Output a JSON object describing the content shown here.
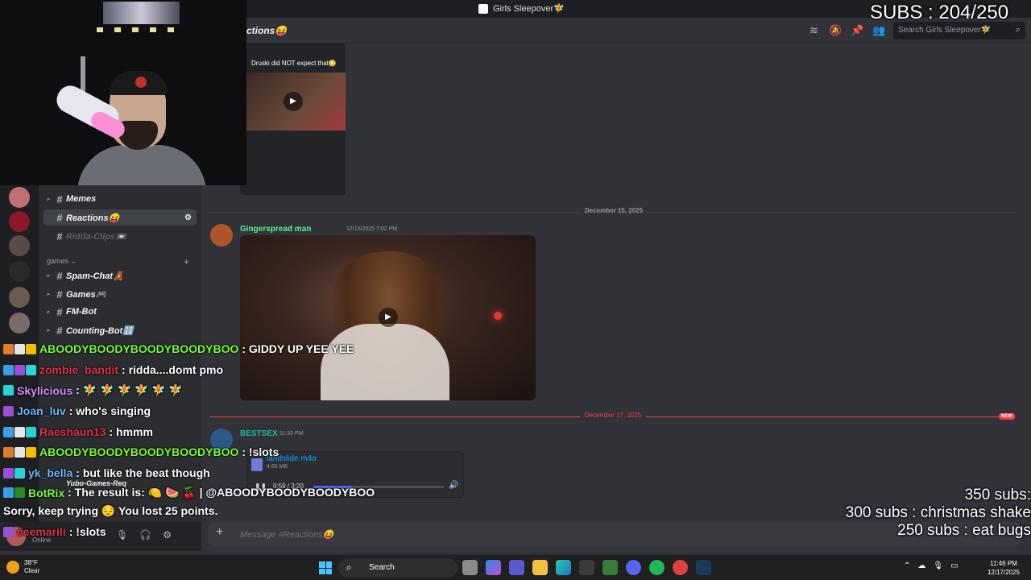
{
  "window": {
    "title": "Girls Sleepover🧚"
  },
  "channel_header": {
    "name": "ctions😝",
    "search_placeholder": "Search Girls Sleepover🧚",
    "icons": [
      "threads-icon",
      "mute-bell-icon",
      "pin-icon",
      "members-icon"
    ]
  },
  "channels": {
    "items": [
      {
        "name": "Memes",
        "active": false,
        "muted": false
      },
      {
        "name": "Reactions😝",
        "active": true,
        "muted": false
      },
      {
        "name": "Ridda-Clips📼",
        "active": false,
        "muted": true
      },
      {
        "name": "Spam-Chat🧸",
        "active": false,
        "muted": false
      },
      {
        "name": "Games🎮",
        "active": false,
        "muted": false
      },
      {
        "name": "FM-Bot",
        "active": false,
        "muted": false
      },
      {
        "name": "Counting-Bot🔢",
        "active": false,
        "muted": false
      },
      {
        "name": "Yubo-Games-Req",
        "active": false,
        "muted": false
      }
    ],
    "category_games": "games ⌄"
  },
  "messages": {
    "top_embed_caption": "Druski did NOT expect that😳",
    "date_1": "December 15, 2025",
    "msg1_author": "Gingerspread man",
    "msg1_time": "12/15/2025 7:02 PM",
    "date_2": "December 17, 2025",
    "new_tag": "NEW",
    "msg2_author": "BESTSEX",
    "msg2_time": "11:33 PM",
    "attachment_name": "landslide.m4a",
    "attachment_size": "4.65 MB",
    "audio_time": "0:59 / 3:20",
    "audio_progress": 0.295
  },
  "composer": {
    "placeholder": "Message #Reactions😝"
  },
  "user_panel": {
    "status": "Online"
  },
  "stream_chat": [
    {
      "name": "ABOODYBOODYBOODYBOODYBOO",
      "color": "#7cfc3a",
      "text": ": GIDDY UP YEE YEE",
      "badges": [
        "#e07b2a",
        "#e6e6e6",
        "#f0c000"
      ]
    },
    {
      "name": "zombie_bandit",
      "color": "#e0324a",
      "text": ": ridda....domt pmo",
      "badges": [
        "#3aa0e0",
        "#9b4fd8",
        "#2ad4d4"
      ]
    },
    {
      "name": "Skylicious",
      "color": "#d58cff",
      "text": ": 🧚 🧚 🧚 🧚 🧚 🧚",
      "badges": [
        "#2ad4d4"
      ]
    },
    {
      "name": "Joan_luv",
      "color": "#6bb8ff",
      "text": ": who's singing",
      "badges": [
        "#9b4fd8"
      ]
    },
    {
      "name": "Raeshaun13",
      "color": "#e0324a",
      "text": ": hmmm",
      "badges": [
        "#3aa0e0",
        "#e6e6e6",
        "#2ad4d4"
      ]
    },
    {
      "name": "ABOODYBOODYBOODYBOODYBOO",
      "color": "#7cfc3a",
      "text": ": !slots",
      "badges": [
        "#e07b2a",
        "#e6e6e6",
        "#f0c000"
      ]
    },
    {
      "name": "yk_bella",
      "color": "#6bb8ff",
      "text": ": but like the beat though",
      "badges": [
        "#9b4fd8",
        "#2ad4d4"
      ]
    },
    {
      "name": "BotRix",
      "color": "#7cfc3a",
      "text": ": The result is: 🍋 🍉 🍒 | @ABOODYBOODYBOODYBOO",
      "badges": [
        "#3aa0e0",
        "#2a8a2a"
      ]
    },
    {
      "name": "",
      "color": "#ffffff",
      "text": "Sorry, keep trying 😔 You lost 25 points.",
      "badges": []
    },
    {
      "name": "ceemarili",
      "color": "#e0324a",
      "text": ": !slots",
      "badges": [
        "#9b4fd8"
      ]
    }
  ],
  "subs_counter": "SUBS : 204/250",
  "sub_goals": [
    "350 subs:",
    "300 subs : christmas shake",
    "250 subs : eat bugs"
  ],
  "taskbar": {
    "temperature": "38°F",
    "condition": "Clear",
    "search_label": "Search",
    "time": "11:46 PM",
    "date": "12/17/2025"
  }
}
